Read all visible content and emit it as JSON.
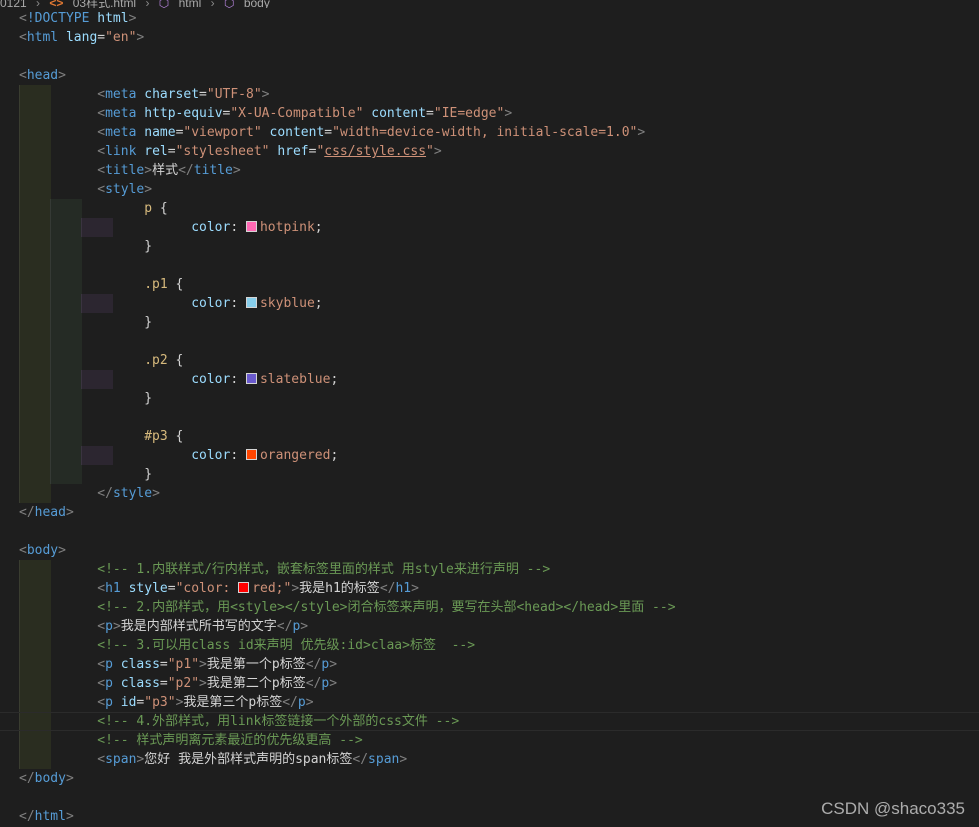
{
  "breadcrumb": {
    "items": [
      "0121",
      "03样式.html",
      "html",
      "body"
    ],
    "file_icon": "html-file-icon",
    "symbol_icon": "symbol-element-icon"
  },
  "colors": {
    "background": "#1e1e1e",
    "hotpink": "#ff69b4",
    "skyblue": "#87ceeb",
    "slateblue": "#6a5acd",
    "orangered": "#ff4500",
    "red": "#ff0000"
  },
  "code": {
    "l1_doctype": "!DOCTYPE",
    "l1_html": "html",
    "l2_html": "html",
    "l2_lang_attr": "lang",
    "l2_lang_val": "\"en\"",
    "head_open": "head",
    "meta1_tag": "meta",
    "meta1_attr": "charset",
    "meta1_val": "\"UTF-8\"",
    "meta2_tag": "meta",
    "meta2_attr1": "http-equiv",
    "meta2_val1": "\"X-UA-Compatible\"",
    "meta2_attr2": "content",
    "meta2_val2": "\"IE=edge\"",
    "meta3_tag": "meta",
    "meta3_attr1": "name",
    "meta3_val1": "\"viewport\"",
    "meta3_attr2": "content",
    "meta3_val2": "\"width=device-width, initial-scale=1.0\"",
    "link_tag": "link",
    "link_attr1": "rel",
    "link_val1": "\"stylesheet\"",
    "link_attr2": "href",
    "link_val2_q1": "\"",
    "link_val2_url": "css/style.css",
    "link_val2_q2": "\"",
    "title_tag": "title",
    "title_text": "样式",
    "style_tag": "style",
    "sel_p": "p",
    "sel_p1": ".p1",
    "sel_p2": ".p2",
    "sel_p3": "#p3",
    "prop_color": "color",
    "val_hotpink": "hotpink",
    "val_skyblue": "skyblue",
    "val_slateblue": "slateblue",
    "val_orangered": "orangered",
    "head_close": "head",
    "body_open": "body",
    "comment1": "<!-- 1.内联样式/行内样式，嵌套标签里面的样式 用style来进行声明 -->",
    "h1_tag": "h1",
    "h1_attr": "style",
    "h1_val_start": "\"color: ",
    "h1_val_end": "red;\"",
    "h1_text": "我是h1的标签",
    "comment2": "<!-- 2.内部样式，用<style></style>闭合标签来声明，要写在头部<head></head>里面 -->",
    "p_tag": "p",
    "p_text": "我是内部样式所书写的文字",
    "comment3": "<!-- 3.可以用class id来声明 优先级:id>claa>标签  -->",
    "class_attr": "class",
    "p1_val": "\"p1\"",
    "p1_text": "我是第一个p标签",
    "p2_val": "\"p2\"",
    "p2_text": "我是第二个p标签",
    "id_attr": "id",
    "p3_val": "\"p3\"",
    "p3_text": "我是第三个p标签",
    "comment4": "<!-- 4.外部样式，用link标签链接一个外部的css文件 -->",
    "comment5": "<!-- 样式声明离元素最近的优先级更高 -->",
    "span_tag": "span",
    "span_text": "您好 我是外部样式声明的span标签",
    "body_close": "body",
    "html_close": "html"
  },
  "watermark": "CSDN @shaco335"
}
